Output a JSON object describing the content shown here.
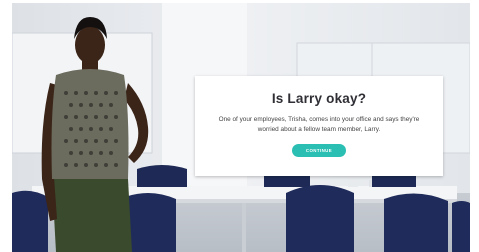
{
  "dialog": {
    "title": "Is Larry okay?",
    "body": "One of your employees, Trisha, comes into your office and says they're worried about a fellow team member, Larry.",
    "continue_label": "CONTINUE"
  },
  "colors": {
    "accent": "#2bbfb4",
    "title_text": "#2f2f35",
    "background_wall": "#e7eaee"
  }
}
